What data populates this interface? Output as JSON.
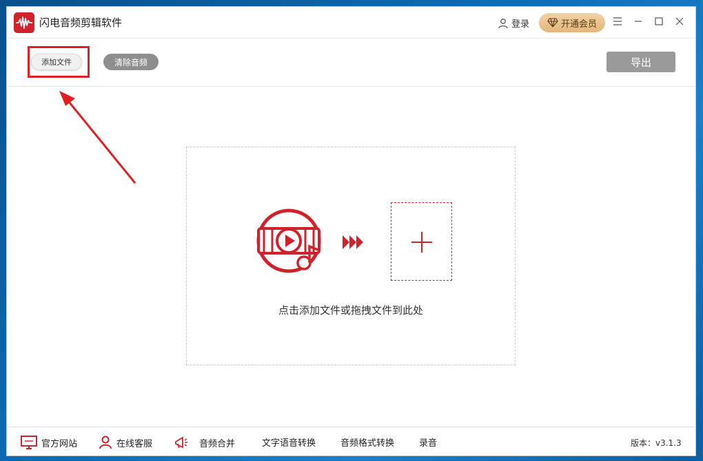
{
  "window": {
    "title": "闪电音频剪辑软件",
    "login_label": "登录",
    "vip_label": "开通会员"
  },
  "toolbar": {
    "add_file_label": "添加文件",
    "clear_audio_label": "清除音频",
    "export_label": "导出"
  },
  "dropzone": {
    "hint": "点击添加文件或拖拽文件到此处"
  },
  "bottombar": {
    "items": [
      {
        "label": "官方网站",
        "icon": "monitor-icon"
      },
      {
        "label": "在线客服",
        "icon": "person-icon"
      },
      {
        "label": "音频合并",
        "icon": "megaphone-icon"
      },
      {
        "label": "文字语音转换"
      },
      {
        "label": "音频格式转换"
      },
      {
        "label": "录音"
      }
    ],
    "version": "版本：v3.1.3"
  },
  "colors": {
    "accent": "#d0222b",
    "highlight": "#e02020",
    "vip": "#e4b67c"
  }
}
